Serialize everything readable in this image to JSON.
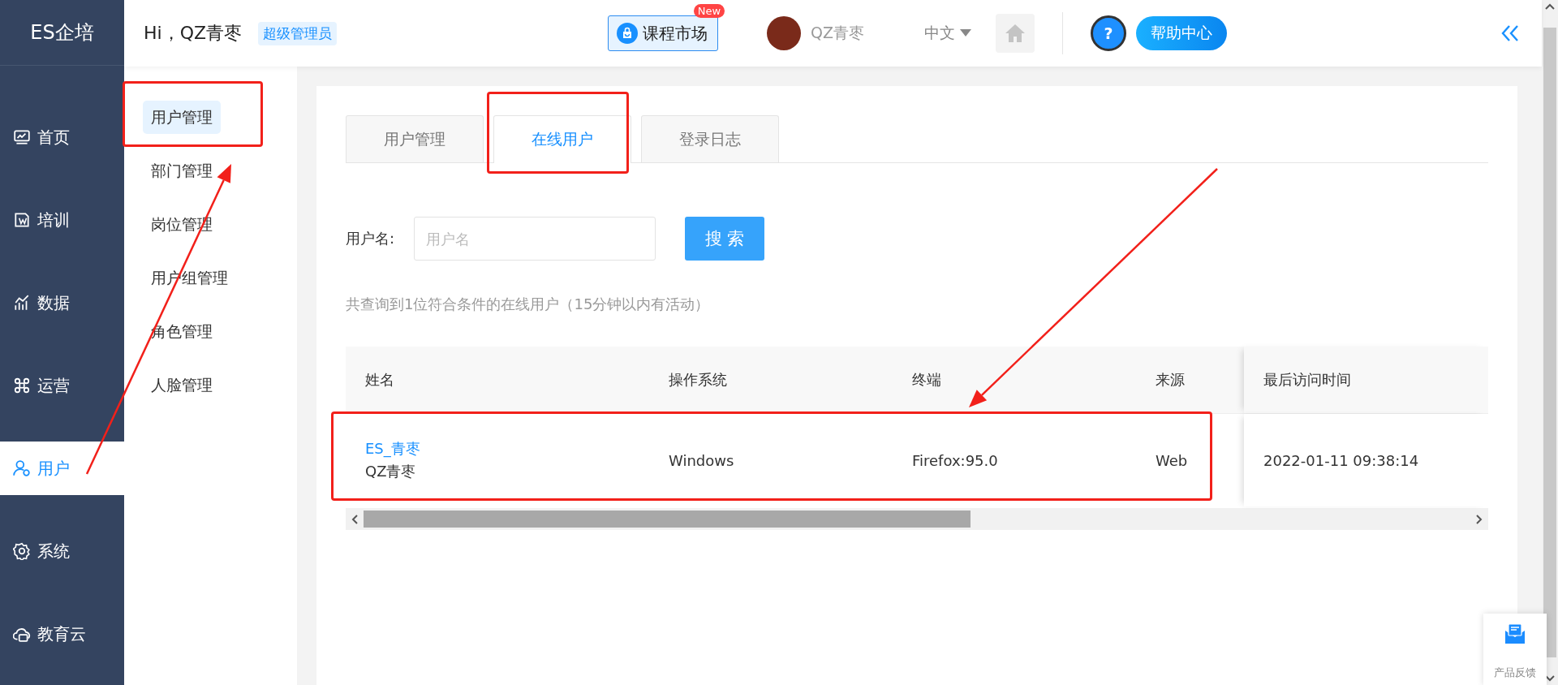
{
  "sidebar": {
    "logo": "ES企培",
    "items": [
      {
        "label": "首页",
        "selected": false
      },
      {
        "label": "培训",
        "selected": false
      },
      {
        "label": "数据",
        "selected": false
      },
      {
        "label": "运营",
        "selected": false
      },
      {
        "label": "用户",
        "selected": true
      },
      {
        "label": "系统",
        "selected": false
      },
      {
        "label": "教育云",
        "selected": false
      }
    ]
  },
  "topbar": {
    "greeting": "Hi，QZ青枣",
    "role_badge": "超级管理员",
    "course_market": "课程市场",
    "new_badge": "New",
    "user_name": "QZ青枣",
    "language": "中文",
    "help_mark": "?",
    "help": "帮助中心"
  },
  "subnav": {
    "items": [
      {
        "label": "用户管理",
        "selected": true
      },
      {
        "label": "部门管理",
        "selected": false
      },
      {
        "label": "岗位管理",
        "selected": false
      },
      {
        "label": "用户组管理",
        "selected": false
      },
      {
        "label": "角色管理",
        "selected": false
      },
      {
        "label": "人脸管理",
        "selected": false
      }
    ]
  },
  "tabs": [
    {
      "label": "用户管理",
      "selected": false
    },
    {
      "label": "在线用户",
      "selected": true
    },
    {
      "label": "登录日志",
      "selected": false
    }
  ],
  "search": {
    "label": "用户名:",
    "placeholder": "用户名",
    "button": "搜 索"
  },
  "summary": "共查询到1位符合条件的在线用户（15分钟以内有活动）",
  "table": {
    "columns": [
      "姓名",
      "操作系统",
      "终端",
      "来源",
      "最后访问时间"
    ],
    "rows": [
      {
        "account": "ES_青枣",
        "name": "QZ青枣",
        "os": "Windows",
        "terminal": "Firefox:95.0",
        "source": "Web",
        "last_visit": "2022-01-11 09:38:14"
      }
    ]
  },
  "feedback": "产品反馈"
}
